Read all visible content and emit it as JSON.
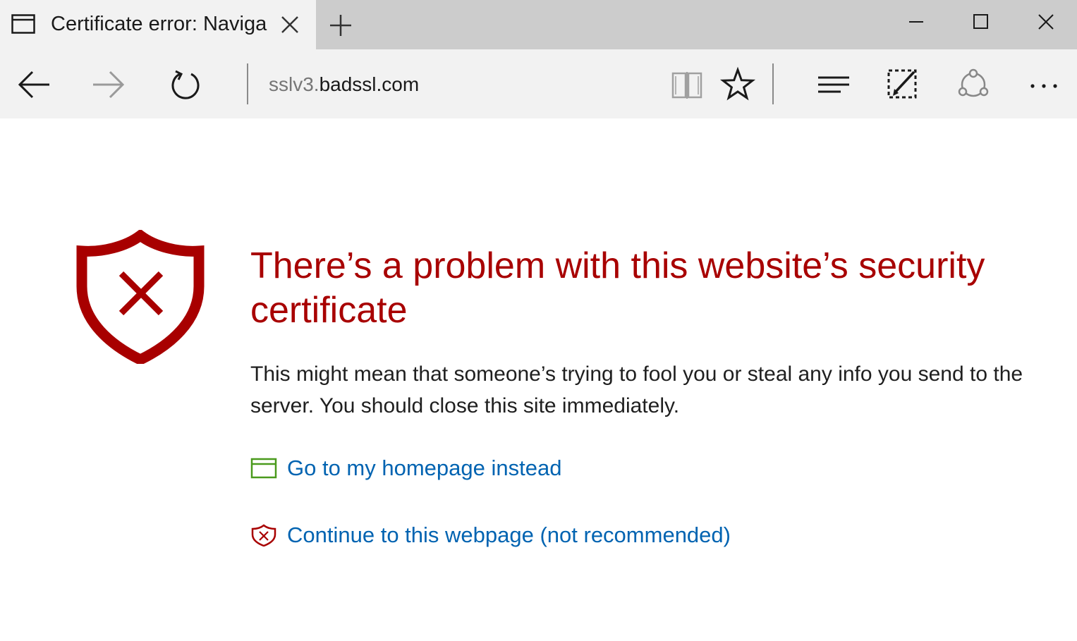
{
  "tab": {
    "title": "Certificate error: Naviga",
    "icon": "tab-page-icon"
  },
  "window_controls": [
    "minimize-icon",
    "maximize-icon",
    "close-icon"
  ],
  "nav": {
    "buttons": [
      "back-arrow-icon",
      "forward-arrow-icon",
      "refresh-icon"
    ],
    "address_prefix": "sslv3.",
    "address_domain": "badssl.com",
    "toolbar": [
      "reading-view-icon",
      "favorite-star-icon",
      "hub-icon",
      "web-note-icon",
      "share-icon",
      "more-icon"
    ]
  },
  "error": {
    "headline": "There’s a problem with this website’s security certificate",
    "description": "This might mean that someone’s trying to fool you or steal any info you send to the server. You should close this site immediately.",
    "homepage_link": "Go to my homepage instead",
    "continue_link": "Continue to this webpage (not recommended)"
  },
  "colors": {
    "error_red": "#a80000",
    "link_blue": "#0063b1",
    "homepage_icon_green": "#4a9a1d",
    "titlebar_bg": "#cccccc",
    "toolbar_bg": "#f2f2f2"
  }
}
